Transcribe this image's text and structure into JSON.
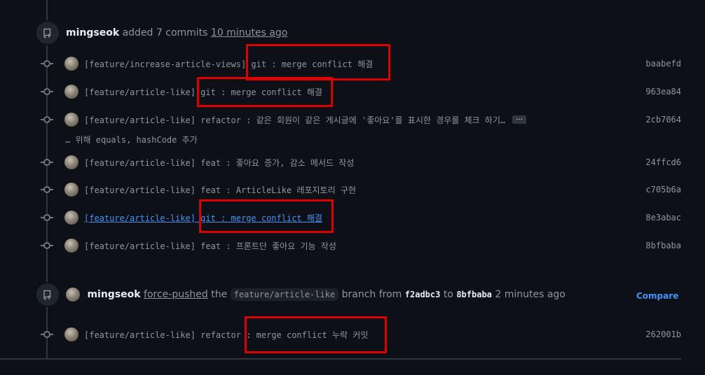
{
  "event1": {
    "author": "mingseok",
    "action": "added 7 commits",
    "time": "10 minutes ago"
  },
  "commits": [
    {
      "msg": "[feature/increase-article-views] git : merge conflict 해결",
      "sha": "baabefd"
    },
    {
      "msg": "[feature/article-like] git : merge conflict 해결",
      "sha": "963ea84"
    },
    {
      "msg": "[feature/article-like] refactor : 같은 회원이 같은 게시글에 '좋아요'를 표시한 경우를 체크 하기…",
      "sha": "2cb7064"
    },
    {
      "msg": "[feature/article-like] feat : 좋아요 증가, 감소 메서드 작성",
      "sha": "24ffcd6"
    },
    {
      "msg": "[feature/article-like] feat : ArticleLike 레포지토리 구현",
      "sha": "c705b6a"
    },
    {
      "msg": "[feature/article-like] git : merge conflict 해결",
      "sha": "8e3abac"
    },
    {
      "msg": "[feature/article-like] feat : 프론트단 좋아요 기능 작성",
      "sha": "8bfbaba"
    }
  ],
  "commit_continuation": "… 위해 equals, hashCode 추가",
  "ellipsis_label": "…",
  "event2": {
    "author": "mingseok",
    "action": "force-pushed",
    "word_the": "the",
    "branch": "feature/article-like",
    "word_branch_from": "branch from",
    "from_sha": "f2adbc3",
    "word_to": "to",
    "to_sha": "8bfbaba",
    "time": "2 minutes ago",
    "compare_label": "Compare"
  },
  "commit_after": {
    "msg": "[feature/article-like] refactor : merge conflict 누락 커밋",
    "sha": "262001b"
  },
  "colors": {
    "background": "#0d1117",
    "highlight_box": "#e00000",
    "link": "#4493f8"
  },
  "icons": {
    "event": "repo-push-icon",
    "commit": "git-commit-icon"
  }
}
